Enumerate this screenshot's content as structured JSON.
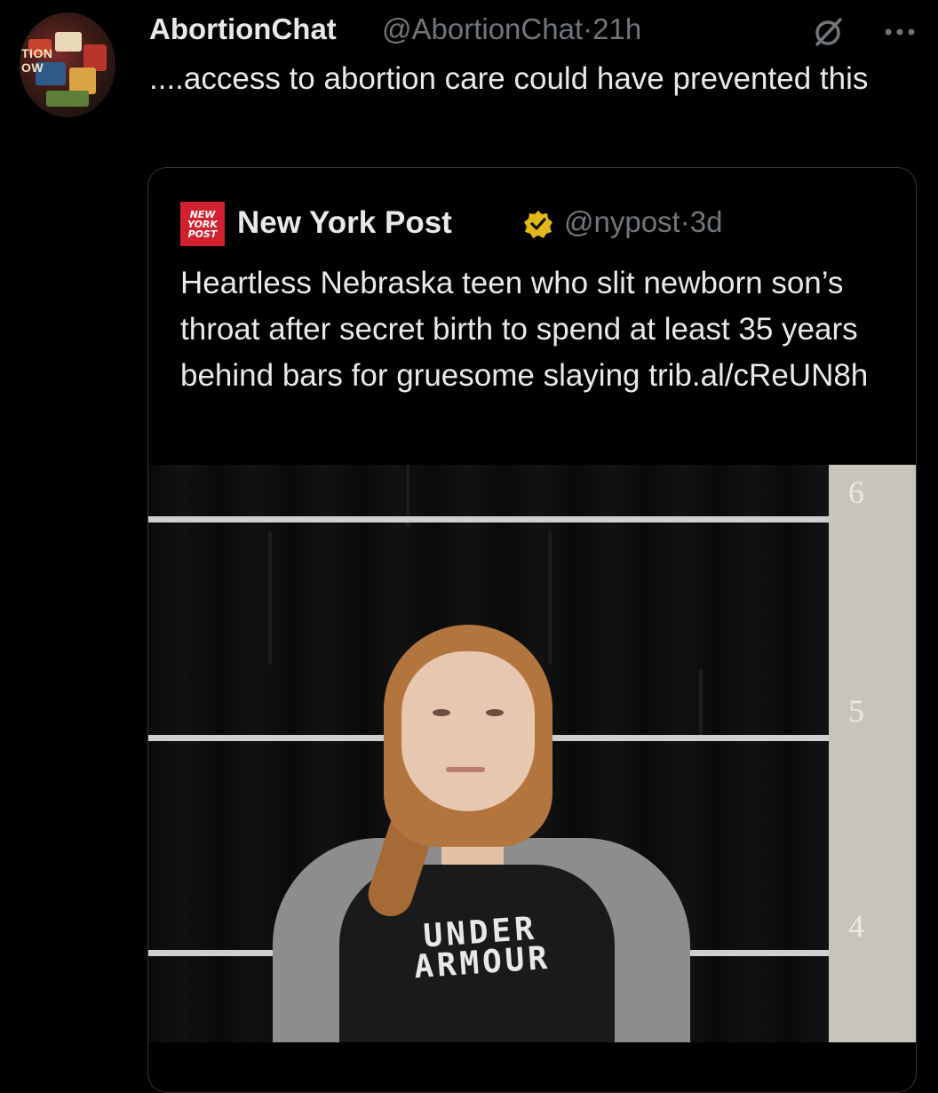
{
  "tweet": {
    "display_name": "AbortionChat",
    "handle": "@AbortionChat",
    "separator": "·",
    "time": "21h",
    "text": "....access to abortion care could have prevented this",
    "avatar_text": "TION\nOW",
    "icons": {
      "grok": "grok-icon",
      "more": "more-options-icon"
    }
  },
  "quote": {
    "logo_text": "NEW YORK POST",
    "display_name": "New York Post",
    "verified": true,
    "handle": "@nypost",
    "separator": "·",
    "time": "3d",
    "text": "Heartless Nebraska teen who slit newborn son’s throat after secret birth to spend at least 35 years behind bars for gruesome slaying trib.al/cReUN8h",
    "media": {
      "ruler_marks": [
        "6",
        "5",
        "4"
      ],
      "shirt_text": "UNDER ARMOUR"
    }
  },
  "colors": {
    "background": "#000000",
    "text": "#e7e9ea",
    "muted": "#71767b",
    "border": "#333639",
    "verified": "#e2b719",
    "nypost_red": "#d1202f"
  }
}
